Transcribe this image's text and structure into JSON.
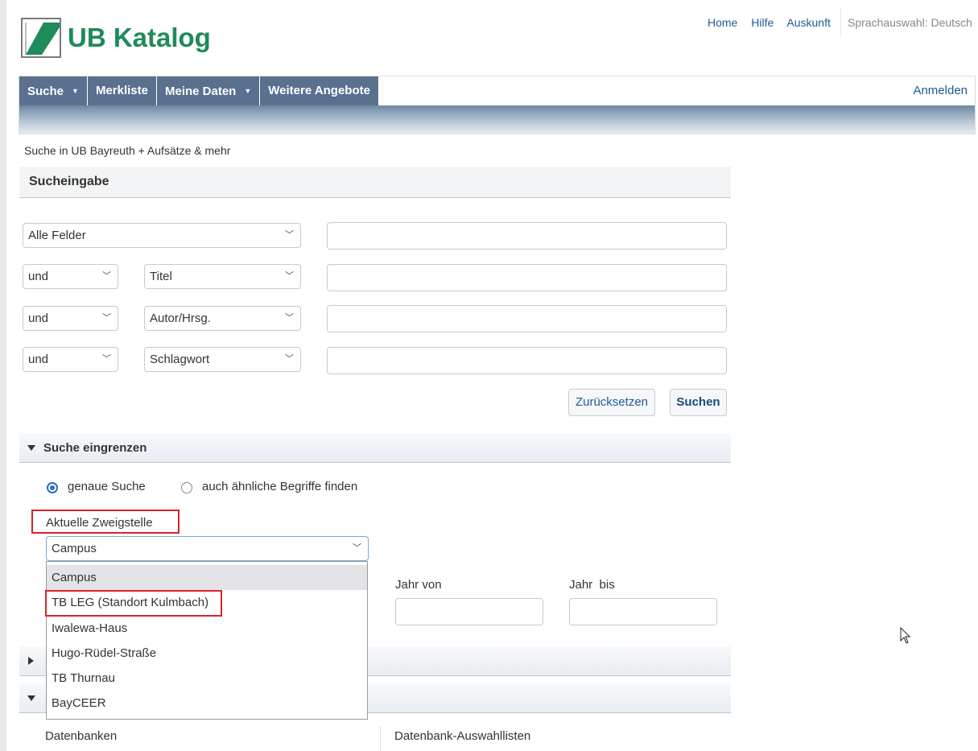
{
  "header": {
    "logo_text": "UB Katalog",
    "links": [
      "Home",
      "Hilfe",
      "Auskunft"
    ],
    "language": "Sprachauswahl: Deutsch"
  },
  "nav": {
    "items": [
      {
        "label": "Suche",
        "dropdown": true
      },
      {
        "label": "Merkliste",
        "dropdown": false
      },
      {
        "label": "Meine Daten",
        "dropdown": true
      },
      {
        "label": "Weitere Angebote",
        "dropdown": false
      }
    ],
    "login": "Anmelden"
  },
  "breadcrumb": "Suche in UB Bayreuth + Aufsätze & mehr",
  "search": {
    "title": "Sucheingabe",
    "rows": [
      {
        "operator": "",
        "field": "Alle Felder",
        "value": ""
      },
      {
        "operator": "und",
        "field": "Titel",
        "value": ""
      },
      {
        "operator": "und",
        "field": "Autor/Hrsg.",
        "value": ""
      },
      {
        "operator": "und",
        "field": "Schlagwort",
        "value": ""
      }
    ],
    "reset_label": "Zurücksetzen",
    "submit_label": "Suchen"
  },
  "refine": {
    "title": "Suche eingrenzen",
    "radio_exact": "genaue Suche",
    "radio_similar": "auch ähnliche Begriffe finden",
    "branch_label": "Aktuelle Zweigstelle",
    "branch_value": "Campus",
    "branch_options": [
      "Campus",
      "TB LEG (Standort Kulmbach)",
      "Iwalewa-Haus",
      "Hugo-Rüdel-Straße",
      "TB Thurnau",
      "BayCEER"
    ],
    "year_from_label": "Jahr von",
    "year_to_label": "Jahr  bis"
  },
  "lower": {
    "databases_label": "Datenbanken",
    "db_lists_label": "Datenbank-Auswahllisten"
  },
  "colors": {
    "nav_bg": "#5a708f",
    "link": "#1e5b94",
    "logo_green": "#1f8a5a",
    "highlight_red": "#d9232a"
  }
}
